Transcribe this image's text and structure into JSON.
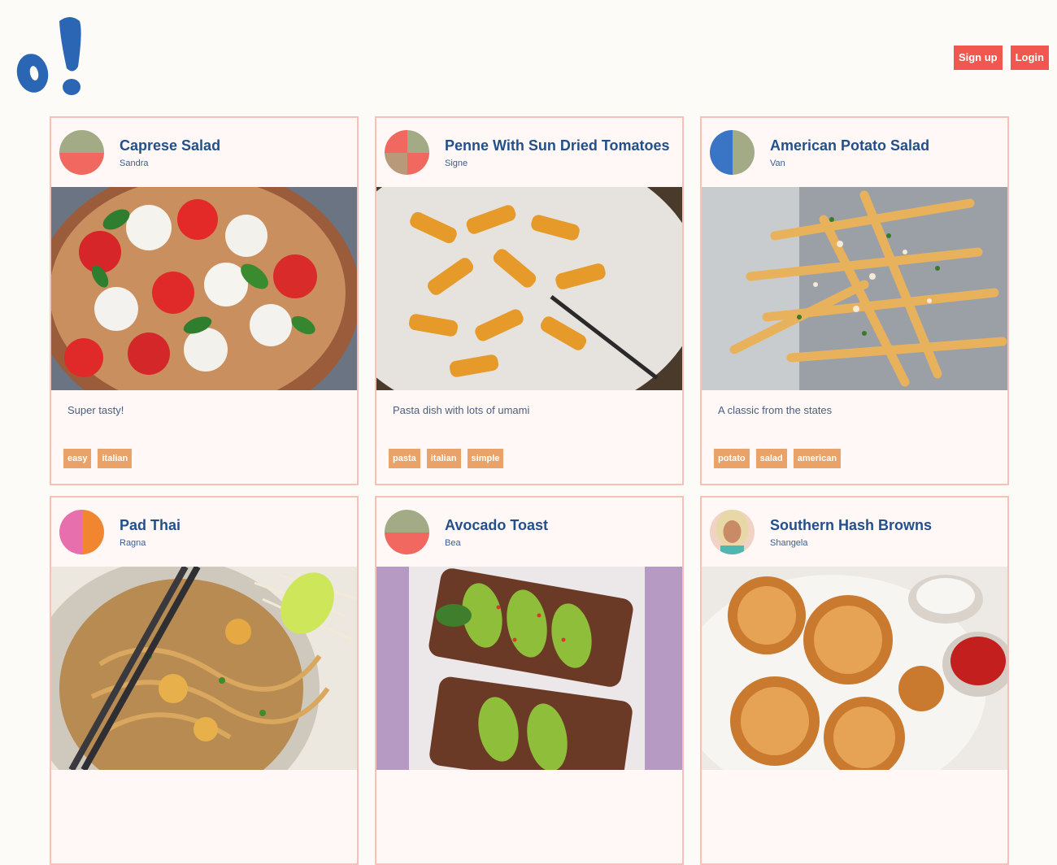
{
  "header": {
    "signup_label": "Sign up",
    "login_label": "Login"
  },
  "colors": {
    "accent": "#f0584f",
    "tag": "#e9a369",
    "brand": "#2b66b5"
  },
  "recipes": [
    {
      "title": "Caprese Salad",
      "author": "Sandra",
      "description": "Super tasty!",
      "tags": [
        "easy",
        "italian"
      ]
    },
    {
      "title": "Penne With Sun Dried Tomatoes",
      "author": "Signe",
      "description": "Pasta dish with lots of umami",
      "tags": [
        "pasta",
        "italian",
        "simple"
      ]
    },
    {
      "title": "American Potato Salad",
      "author": "Van",
      "description": "A classic from the states",
      "tags": [
        "potato",
        "salad",
        "american"
      ]
    },
    {
      "title": "Pad Thai",
      "author": "Ragna",
      "description": "",
      "tags": []
    },
    {
      "title": "Avocado Toast",
      "author": "Bea",
      "description": "",
      "tags": []
    },
    {
      "title": "Southern Hash Browns",
      "author": "Shangela",
      "description": "",
      "tags": []
    }
  ]
}
